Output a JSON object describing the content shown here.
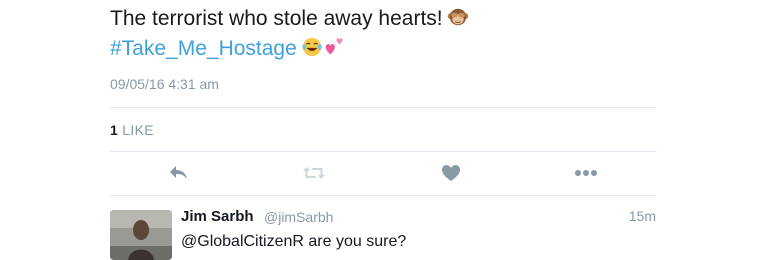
{
  "tweet": {
    "text": "The terrorist who stole away hearts!",
    "emoji_after_text": "see-no-evil-monkey-icon",
    "hashtag": "#Take_Me_Hostage",
    "emojis_after_hashtag": [
      "tears-of-joy-icon",
      "two-hearts-icon"
    ],
    "timestamp": "09/05/16 4:31 am",
    "like_count": "1",
    "like_label": "LIKE"
  },
  "actions": {
    "icons": [
      "reply-icon",
      "retweet-icon",
      "like-heart-icon",
      "more-icon"
    ],
    "icon_color": "#8899a6"
  },
  "reply": {
    "name": "Jim Sarbh",
    "handle": "@jimSarbh",
    "time": "15m",
    "text": "@GlobalCitizenR are you sure?"
  },
  "colors": {
    "hashtag": "#3ea1d9",
    "secondary_text": "#8899a6",
    "divider": "#e1e8ed"
  }
}
